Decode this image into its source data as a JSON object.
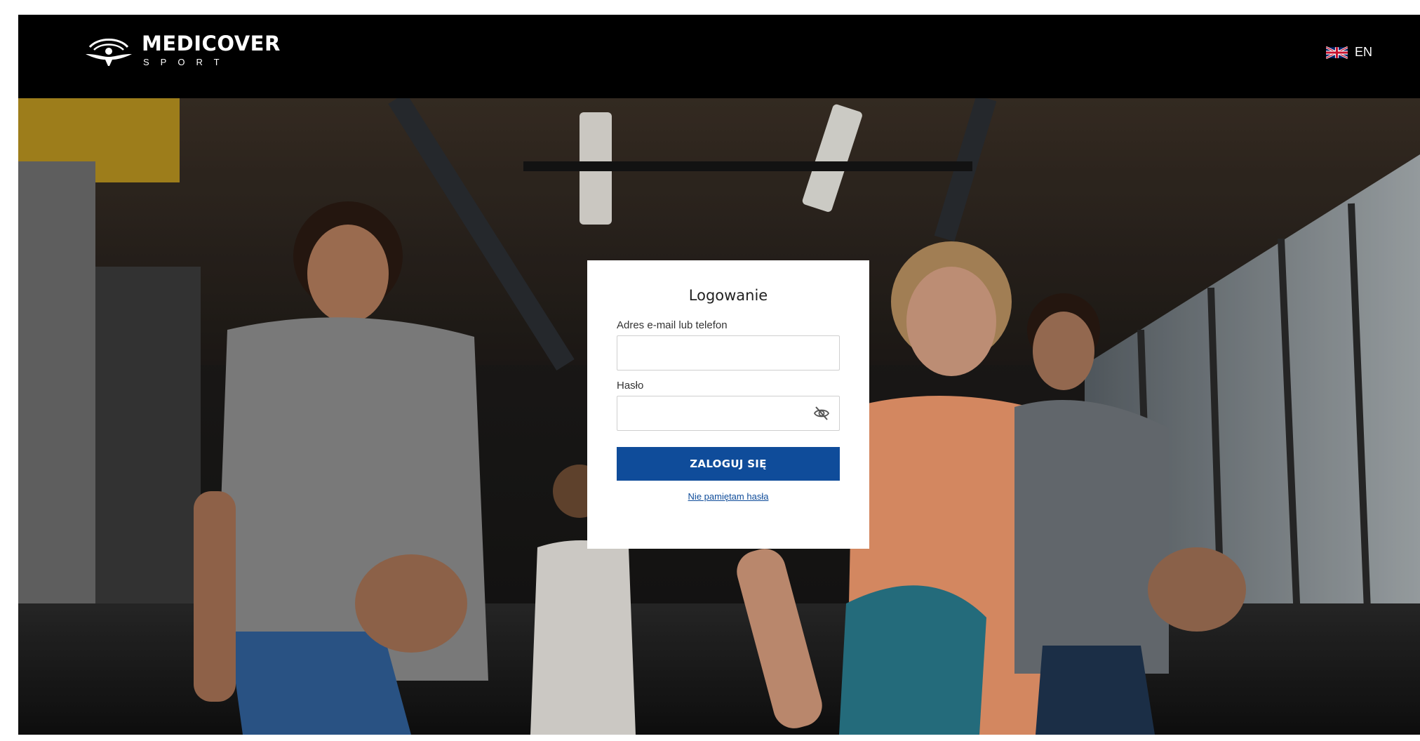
{
  "header": {
    "brand_name": "MEDICOVER",
    "brand_sub": "SPORT",
    "logo_icon": "medicover-figure-icon",
    "language": {
      "label": "EN",
      "flag_icon": "uk-flag-icon"
    }
  },
  "login": {
    "title": "Logowanie",
    "email_label": "Adres e-mail lub telefon",
    "email_value": "",
    "password_label": "Hasło",
    "password_value": "",
    "password_toggle_icon": "eye-slash-icon",
    "submit_label": "ZALOGUJ SIĘ",
    "forgot_label": "Nie pamiętam hasła"
  },
  "colors": {
    "primary": "#0f4c9a",
    "header_bg": "#000000",
    "card_bg": "#ffffff"
  }
}
